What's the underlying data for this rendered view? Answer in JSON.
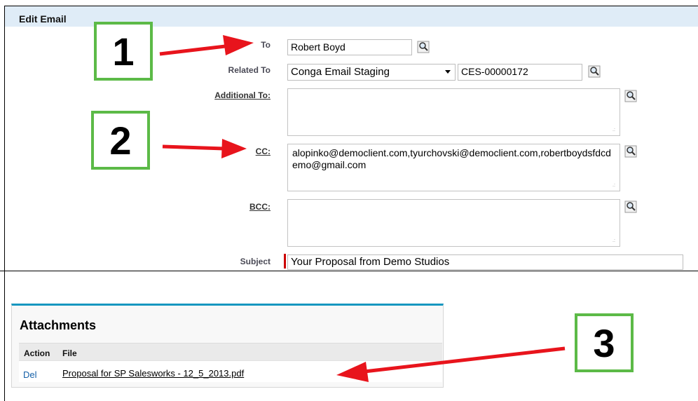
{
  "panel": {
    "title": "Edit Email"
  },
  "form": {
    "to_label": "To",
    "to_value": "Robert Boyd",
    "related_label": "Related To",
    "related_type": "Conga Email Staging",
    "related_value": "CES-00000172",
    "additional_label": "Additional To:",
    "additional_value": "",
    "cc_label": "CC:",
    "cc_value": "alopinko@democlient.com,tyurchovski@democlient.com,robertboydsfdcdemo@gmail.com",
    "bcc_label": "BCC:",
    "bcc_value": "",
    "subject_label": "Subject",
    "subject_value": "Your Proposal from Demo Studios"
  },
  "attachments": {
    "title": "Attachments",
    "columns": [
      "Action",
      "File"
    ],
    "rows": [
      {
        "action": "Del",
        "file": "Proposal for SP Salesworks - 12_5_2013.pdf"
      }
    ]
  },
  "callouts": [
    "1",
    "2",
    "3"
  ],
  "colors": {
    "header_bg": "#dfecf7",
    "callout_border": "#5cba47",
    "arrow": "#e8141c",
    "link": "#1560a8",
    "required": "#cc0000"
  }
}
